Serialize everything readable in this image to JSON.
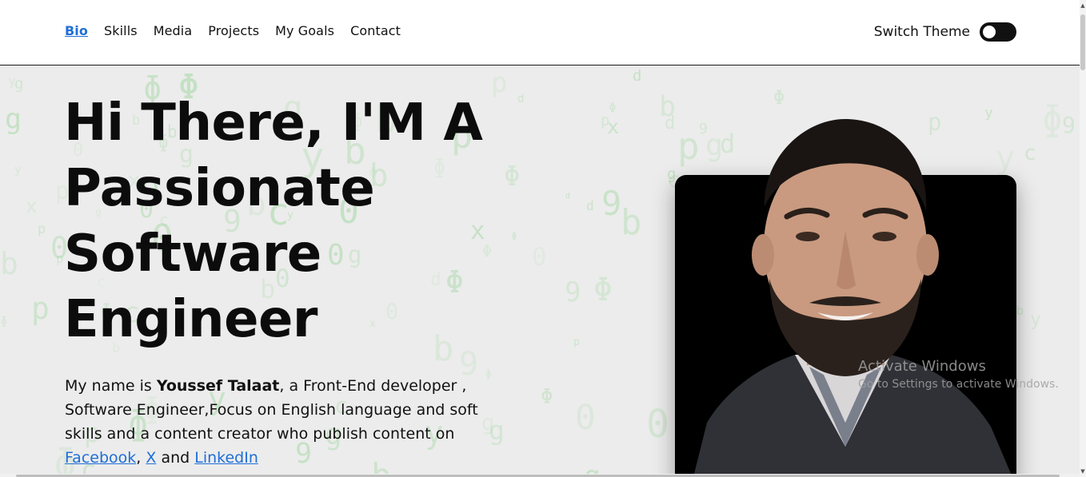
{
  "nav": {
    "links": [
      {
        "label": "Bio",
        "active": true
      },
      {
        "label": "Skills",
        "active": false
      },
      {
        "label": "Media",
        "active": false
      },
      {
        "label": "Projects",
        "active": false
      },
      {
        "label": "My Goals",
        "active": false
      },
      {
        "label": "Contact",
        "active": false
      }
    ],
    "theme_label": "Switch Theme",
    "theme_toggle_state": "off"
  },
  "hero": {
    "headline_lines": [
      "Hi There, I'M A",
      "Passionate",
      "Software",
      "Engineer"
    ],
    "intro": {
      "prefix": "My name is ",
      "name": "Youssef Talaat",
      "after_name": ", a Front-End developer , Software Engineer,Focus on English language and soft skills and a content creator who publish content on ",
      "link1": "Facebook",
      "sep1": ", ",
      "link2": "X",
      "sep2": " and ",
      "link3": "LinkedIn"
    }
  },
  "photo": {
    "subject": "portrait-photo",
    "background": "#000000"
  },
  "watermark": {
    "line1": "Activate Windows",
    "line2": "Go to Settings to activate Windows."
  },
  "colors": {
    "accent_link": "#1f6fd6",
    "hero_bg": "#ececec",
    "matrix_green": "#6ac86a",
    "toggle": "#111111"
  }
}
